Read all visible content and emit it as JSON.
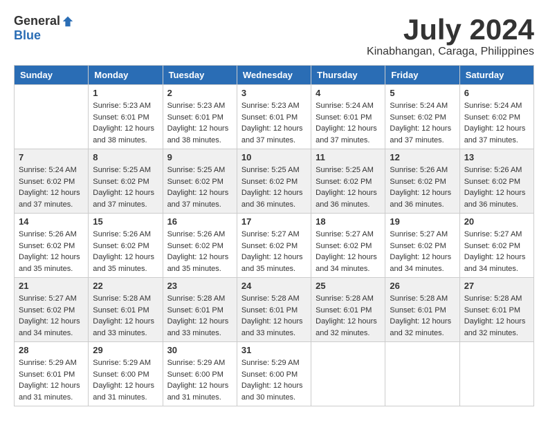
{
  "logo": {
    "general": "General",
    "blue": "Blue"
  },
  "title": {
    "month_year": "July 2024",
    "location": "Kinabhangan, Caraga, Philippines"
  },
  "weekdays": [
    "Sunday",
    "Monday",
    "Tuesday",
    "Wednesday",
    "Thursday",
    "Friday",
    "Saturday"
  ],
  "weeks": [
    [
      {
        "day": "",
        "sunrise": "",
        "sunset": "",
        "daylight": ""
      },
      {
        "day": "1",
        "sunrise": "Sunrise: 5:23 AM",
        "sunset": "Sunset: 6:01 PM",
        "daylight": "Daylight: 12 hours and 38 minutes."
      },
      {
        "day": "2",
        "sunrise": "Sunrise: 5:23 AM",
        "sunset": "Sunset: 6:01 PM",
        "daylight": "Daylight: 12 hours and 38 minutes."
      },
      {
        "day": "3",
        "sunrise": "Sunrise: 5:23 AM",
        "sunset": "Sunset: 6:01 PM",
        "daylight": "Daylight: 12 hours and 37 minutes."
      },
      {
        "day": "4",
        "sunrise": "Sunrise: 5:24 AM",
        "sunset": "Sunset: 6:01 PM",
        "daylight": "Daylight: 12 hours and 37 minutes."
      },
      {
        "day": "5",
        "sunrise": "Sunrise: 5:24 AM",
        "sunset": "Sunset: 6:02 PM",
        "daylight": "Daylight: 12 hours and 37 minutes."
      },
      {
        "day": "6",
        "sunrise": "Sunrise: 5:24 AM",
        "sunset": "Sunset: 6:02 PM",
        "daylight": "Daylight: 12 hours and 37 minutes."
      }
    ],
    [
      {
        "day": "7",
        "sunrise": "Sunrise: 5:24 AM",
        "sunset": "Sunset: 6:02 PM",
        "daylight": "Daylight: 12 hours and 37 minutes."
      },
      {
        "day": "8",
        "sunrise": "Sunrise: 5:25 AM",
        "sunset": "Sunset: 6:02 PM",
        "daylight": "Daylight: 12 hours and 37 minutes."
      },
      {
        "day": "9",
        "sunrise": "Sunrise: 5:25 AM",
        "sunset": "Sunset: 6:02 PM",
        "daylight": "Daylight: 12 hours and 37 minutes."
      },
      {
        "day": "10",
        "sunrise": "Sunrise: 5:25 AM",
        "sunset": "Sunset: 6:02 PM",
        "daylight": "Daylight: 12 hours and 36 minutes."
      },
      {
        "day": "11",
        "sunrise": "Sunrise: 5:25 AM",
        "sunset": "Sunset: 6:02 PM",
        "daylight": "Daylight: 12 hours and 36 minutes."
      },
      {
        "day": "12",
        "sunrise": "Sunrise: 5:26 AM",
        "sunset": "Sunset: 6:02 PM",
        "daylight": "Daylight: 12 hours and 36 minutes."
      },
      {
        "day": "13",
        "sunrise": "Sunrise: 5:26 AM",
        "sunset": "Sunset: 6:02 PM",
        "daylight": "Daylight: 12 hours and 36 minutes."
      }
    ],
    [
      {
        "day": "14",
        "sunrise": "Sunrise: 5:26 AM",
        "sunset": "Sunset: 6:02 PM",
        "daylight": "Daylight: 12 hours and 35 minutes."
      },
      {
        "day": "15",
        "sunrise": "Sunrise: 5:26 AM",
        "sunset": "Sunset: 6:02 PM",
        "daylight": "Daylight: 12 hours and 35 minutes."
      },
      {
        "day": "16",
        "sunrise": "Sunrise: 5:26 AM",
        "sunset": "Sunset: 6:02 PM",
        "daylight": "Daylight: 12 hours and 35 minutes."
      },
      {
        "day": "17",
        "sunrise": "Sunrise: 5:27 AM",
        "sunset": "Sunset: 6:02 PM",
        "daylight": "Daylight: 12 hours and 35 minutes."
      },
      {
        "day": "18",
        "sunrise": "Sunrise: 5:27 AM",
        "sunset": "Sunset: 6:02 PM",
        "daylight": "Daylight: 12 hours and 34 minutes."
      },
      {
        "day": "19",
        "sunrise": "Sunrise: 5:27 AM",
        "sunset": "Sunset: 6:02 PM",
        "daylight": "Daylight: 12 hours and 34 minutes."
      },
      {
        "day": "20",
        "sunrise": "Sunrise: 5:27 AM",
        "sunset": "Sunset: 6:02 PM",
        "daylight": "Daylight: 12 hours and 34 minutes."
      }
    ],
    [
      {
        "day": "21",
        "sunrise": "Sunrise: 5:27 AM",
        "sunset": "Sunset: 6:02 PM",
        "daylight": "Daylight: 12 hours and 34 minutes."
      },
      {
        "day": "22",
        "sunrise": "Sunrise: 5:28 AM",
        "sunset": "Sunset: 6:01 PM",
        "daylight": "Daylight: 12 hours and 33 minutes."
      },
      {
        "day": "23",
        "sunrise": "Sunrise: 5:28 AM",
        "sunset": "Sunset: 6:01 PM",
        "daylight": "Daylight: 12 hours and 33 minutes."
      },
      {
        "day": "24",
        "sunrise": "Sunrise: 5:28 AM",
        "sunset": "Sunset: 6:01 PM",
        "daylight": "Daylight: 12 hours and 33 minutes."
      },
      {
        "day": "25",
        "sunrise": "Sunrise: 5:28 AM",
        "sunset": "Sunset: 6:01 PM",
        "daylight": "Daylight: 12 hours and 32 minutes."
      },
      {
        "day": "26",
        "sunrise": "Sunrise: 5:28 AM",
        "sunset": "Sunset: 6:01 PM",
        "daylight": "Daylight: 12 hours and 32 minutes."
      },
      {
        "day": "27",
        "sunrise": "Sunrise: 5:28 AM",
        "sunset": "Sunset: 6:01 PM",
        "daylight": "Daylight: 12 hours and 32 minutes."
      }
    ],
    [
      {
        "day": "28",
        "sunrise": "Sunrise: 5:29 AM",
        "sunset": "Sunset: 6:01 PM",
        "daylight": "Daylight: 12 hours and 31 minutes."
      },
      {
        "day": "29",
        "sunrise": "Sunrise: 5:29 AM",
        "sunset": "Sunset: 6:00 PM",
        "daylight": "Daylight: 12 hours and 31 minutes."
      },
      {
        "day": "30",
        "sunrise": "Sunrise: 5:29 AM",
        "sunset": "Sunset: 6:00 PM",
        "daylight": "Daylight: 12 hours and 31 minutes."
      },
      {
        "day": "31",
        "sunrise": "Sunrise: 5:29 AM",
        "sunset": "Sunset: 6:00 PM",
        "daylight": "Daylight: 12 hours and 30 minutes."
      },
      {
        "day": "",
        "sunrise": "",
        "sunset": "",
        "daylight": ""
      },
      {
        "day": "",
        "sunrise": "",
        "sunset": "",
        "daylight": ""
      },
      {
        "day": "",
        "sunrise": "",
        "sunset": "",
        "daylight": ""
      }
    ]
  ]
}
